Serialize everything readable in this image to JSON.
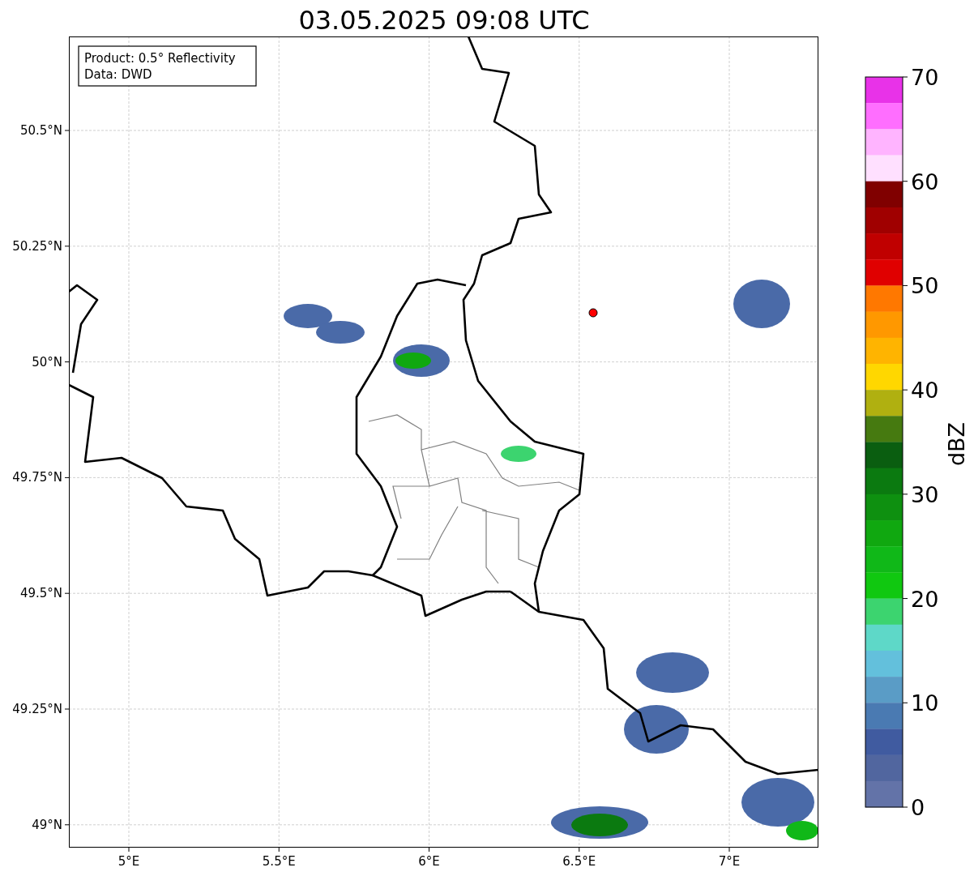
{
  "title": "03.05.2025 09:08 UTC",
  "info_box": [
    "Product: 0.5° Reflectivity",
    "Data: DWD"
  ],
  "map": {
    "x_ticks": [
      "5°E",
      "5.5°E",
      "6°E",
      "6.5°E",
      "7°E"
    ],
    "y_ticks": [
      "50.5°N",
      "50.25°N",
      "50°N",
      "49.75°N",
      "49.5°N",
      "49.25°N",
      "49°N"
    ]
  },
  "colorbar": {
    "label": "dBZ",
    "ticks": [
      "70",
      "60",
      "50",
      "40",
      "30",
      "20",
      "10",
      "0"
    ],
    "bands": [
      {
        "color": "#e832e8"
      },
      {
        "color": "#ff6eff"
      },
      {
        "color": "#ffb4ff"
      },
      {
        "color": "#ffe0ff"
      },
      {
        "color": "#800000"
      },
      {
        "color": "#a00000"
      },
      {
        "color": "#c00000"
      },
      {
        "color": "#e00000"
      },
      {
        "color": "#ff7800"
      },
      {
        "color": "#ff9800"
      },
      {
        "color": "#ffb400"
      },
      {
        "color": "#ffd700"
      },
      {
        "color": "#b0b010"
      },
      {
        "color": "#467a10"
      },
      {
        "color": "#0a5e10"
      },
      {
        "color": "#0b7a10"
      },
      {
        "color": "#0e9010"
      },
      {
        "color": "#10a810"
      },
      {
        "color": "#10b818"
      },
      {
        "color": "#10c810"
      },
      {
        "color": "#3cd46f"
      },
      {
        "color": "#5ed8c8"
      },
      {
        "color": "#63c0dc"
      },
      {
        "color": "#5a9cc6"
      },
      {
        "color": "#4a7ab2"
      },
      {
        "color": "#405ba0"
      },
      {
        "color": "#51669f"
      },
      {
        "color": "#6373a8"
      }
    ]
  }
}
